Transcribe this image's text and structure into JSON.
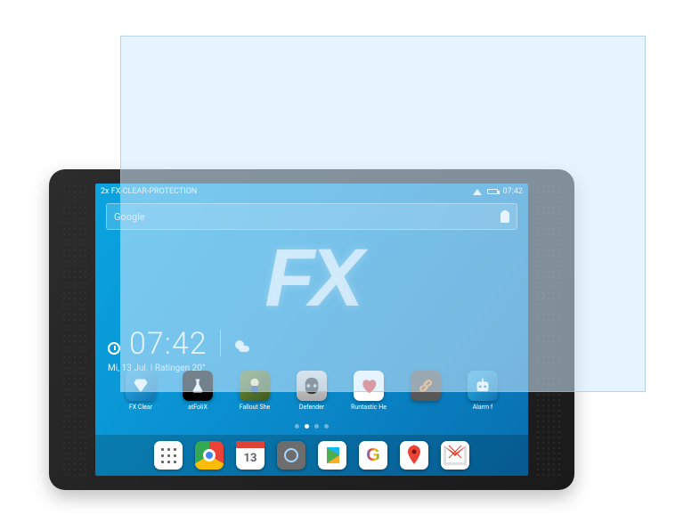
{
  "product_label": "2x FX-CLEAR-PROTECTION",
  "statusbar": {
    "time": "07:42"
  },
  "search": {
    "placeholder": "Google"
  },
  "watermark": "FX",
  "clock": {
    "time": "07:42",
    "date": "Mi, 13 Jul.",
    "sep": "|",
    "location": "Ratingen",
    "temp": "20°"
  },
  "apps": [
    {
      "label": "FX Clear"
    },
    {
      "label": "atFoliX"
    },
    {
      "label": "Fallout She"
    },
    {
      "label": "Defender"
    },
    {
      "label": "Runtastic He"
    },
    {
      "label": ""
    },
    {
      "label": "Alarm f"
    }
  ],
  "calendar_day": "13"
}
